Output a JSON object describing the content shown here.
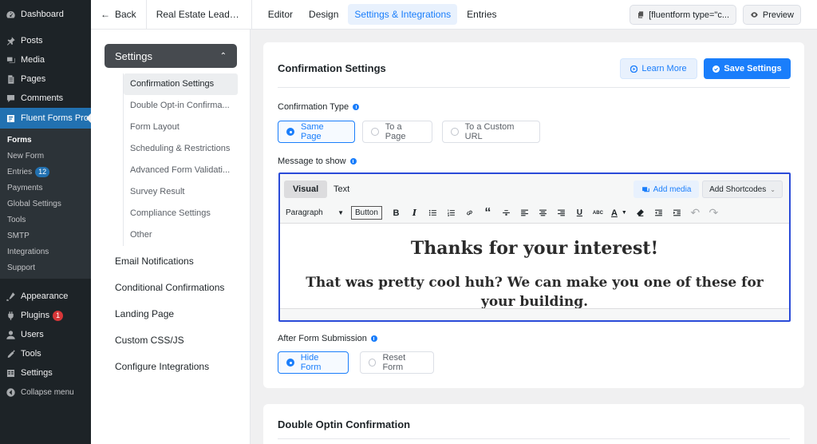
{
  "wp_menu": {
    "items_top": [
      {
        "label": "Dashboard",
        "icon": "dashboard-icon"
      },
      {
        "label": "Posts",
        "icon": "pin-icon"
      },
      {
        "label": "Media",
        "icon": "media-icon"
      },
      {
        "label": "Pages",
        "icon": "pages-icon"
      },
      {
        "label": "Comments",
        "icon": "comments-icon"
      },
      {
        "label": "Fluent Forms Pro",
        "icon": "fluent-forms-icon"
      }
    ],
    "submenu": [
      {
        "label": "Forms"
      },
      {
        "label": "New Form"
      },
      {
        "label": "Entries",
        "badge": "12"
      },
      {
        "label": "Payments"
      },
      {
        "label": "Global Settings"
      },
      {
        "label": "Tools"
      },
      {
        "label": "SMTP"
      },
      {
        "label": "Integrations"
      },
      {
        "label": "Support"
      }
    ],
    "items_bottom": [
      {
        "label": "Appearance",
        "icon": "appearance-icon"
      },
      {
        "label": "Plugins",
        "icon": "plugins-icon",
        "badge": "1"
      },
      {
        "label": "Users",
        "icon": "users-icon"
      },
      {
        "label": "Tools",
        "icon": "tools-icon"
      },
      {
        "label": "Settings",
        "icon": "settings-icon"
      },
      {
        "label": "Collapse menu",
        "icon": "collapse-icon"
      }
    ]
  },
  "topbar": {
    "back": "Back",
    "form_title": "Real Estate Lead Ge...",
    "tabs": [
      "Editor",
      "Design",
      "Settings & Integrations",
      "Entries"
    ],
    "active_tab": "Settings & Integrations",
    "shortcode": "[fluentform type=\"c...",
    "preview": "Preview"
  },
  "settings_nav": {
    "header": "Settings",
    "subitems": [
      "Confirmation Settings",
      "Double Opt-in Confirma...",
      "Form Layout",
      "Scheduling & Restrictions",
      "Advanced Form Validati...",
      "Survey Result",
      "Compliance Settings",
      "Other"
    ],
    "links": [
      "Email Notifications",
      "Conditional Confirmations",
      "Landing Page",
      "Custom CSS/JS",
      "Configure Integrations"
    ]
  },
  "card": {
    "title": "Confirmation Settings",
    "learn_more": "Learn More",
    "save": "Save Settings",
    "confirmation_type_label": "Confirmation Type",
    "confirmation_options": [
      "Same Page",
      "To a Page",
      "To a Custom URL"
    ],
    "message_label": "Message to show",
    "editor": {
      "tab_visual": "Visual",
      "tab_text": "Text",
      "add_media": "Add media",
      "add_shortcodes": "Add Shortcodes",
      "format": "Paragraph",
      "button": "Button",
      "heading": "Thanks for your interest!",
      "paragraph": "That was pretty cool huh? We can make you one of these for your building."
    },
    "after_label": "After Form Submission",
    "after_options": [
      "Hide Form",
      "Reset Form"
    ]
  },
  "card2": {
    "title": "Double Optin Confirmation"
  },
  "colors": {
    "accent": "#1a7efb",
    "wp_sidebar": "#1d2327",
    "wp_active": "#2271b1"
  }
}
